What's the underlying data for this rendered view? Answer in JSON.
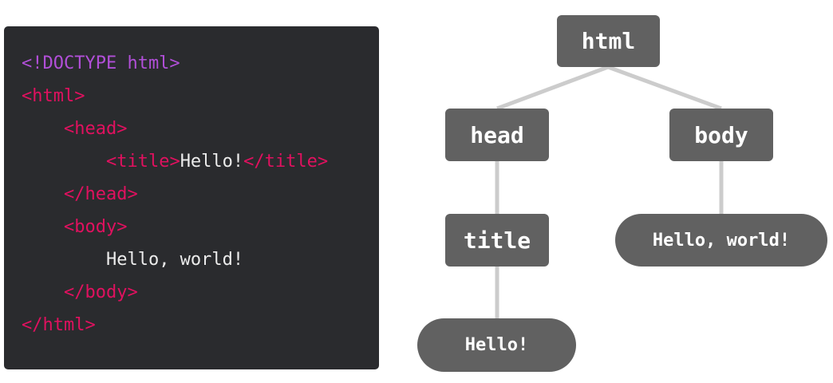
{
  "code": {
    "lines": [
      {
        "parts": [
          {
            "t": "<!DOCTYPE html>",
            "k": "doctype"
          }
        ]
      },
      {
        "parts": [
          {
            "t": "<html>",
            "k": "tag"
          }
        ]
      },
      {
        "parts": [
          {
            "t": "    ",
            "k": "text"
          },
          {
            "t": "<head>",
            "k": "tag"
          }
        ]
      },
      {
        "parts": [
          {
            "t": "        ",
            "k": "text"
          },
          {
            "t": "<title>",
            "k": "tag"
          },
          {
            "t": "Hello!",
            "k": "text"
          },
          {
            "t": "</title>",
            "k": "tag"
          }
        ]
      },
      {
        "parts": [
          {
            "t": "    ",
            "k": "text"
          },
          {
            "t": "</head>",
            "k": "tag"
          }
        ]
      },
      {
        "parts": [
          {
            "t": "    ",
            "k": "text"
          },
          {
            "t": "<body>",
            "k": "tag"
          }
        ]
      },
      {
        "parts": [
          {
            "t": "        ",
            "k": "text"
          },
          {
            "t": "Hello, world!",
            "k": "text"
          }
        ]
      },
      {
        "parts": [
          {
            "t": "    ",
            "k": "text"
          },
          {
            "t": "</body>",
            "k": "tag"
          }
        ]
      },
      {
        "parts": [
          {
            "t": "</html>",
            "k": "tag"
          }
        ]
      }
    ]
  },
  "tree": {
    "nodes": {
      "html": {
        "label": "html",
        "kind": "element"
      },
      "head": {
        "label": "head",
        "kind": "element"
      },
      "body": {
        "label": "body",
        "kind": "element"
      },
      "title": {
        "label": "title",
        "kind": "element"
      },
      "hello": {
        "label": "Hello!",
        "kind": "text"
      },
      "hello_world": {
        "label": "Hello, world!",
        "kind": "text"
      }
    },
    "edges": [
      {
        "from": "html",
        "to": "head"
      },
      {
        "from": "html",
        "to": "body"
      },
      {
        "from": "head",
        "to": "title"
      },
      {
        "from": "title",
        "to": "hello"
      },
      {
        "from": "body",
        "to": "hello_world"
      }
    ]
  },
  "colors": {
    "panel_background": "#2a2b2e",
    "doctype": "#b14fd8",
    "tag": "#e0115f",
    "code_text": "#ececec",
    "node_fill": "#616161",
    "node_text": "#ffffff",
    "edge": "#cccccc"
  }
}
